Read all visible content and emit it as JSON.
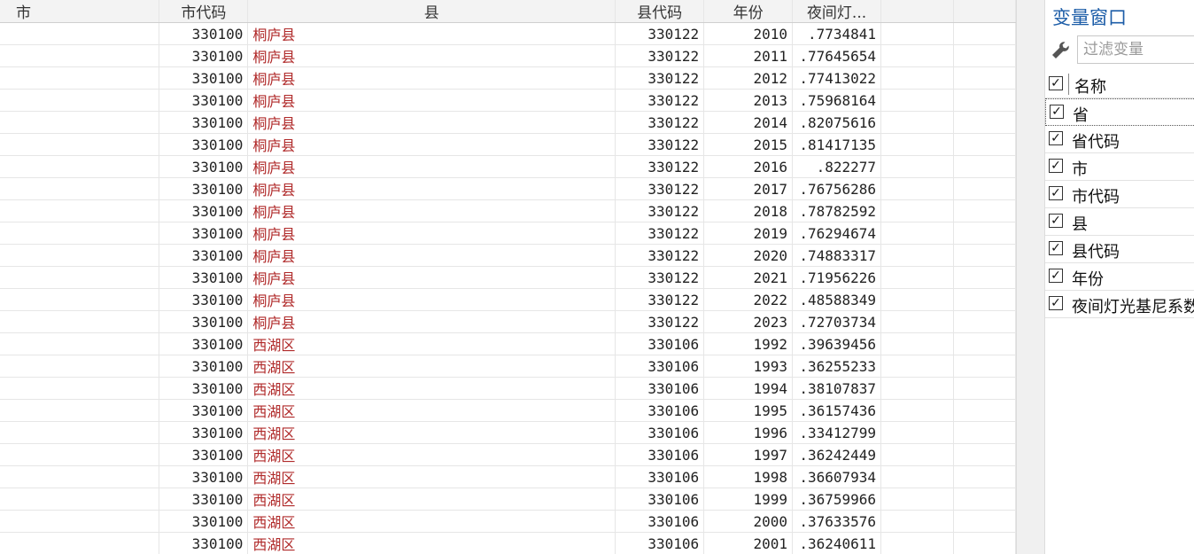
{
  "grid": {
    "columns": [
      "市",
      "市代码",
      "县",
      "县代码",
      "年份",
      "夜间灯..."
    ],
    "rows": [
      [
        "",
        "330100",
        "桐庐县",
        "330122",
        "2010",
        ".7734841"
      ],
      [
        "",
        "330100",
        "桐庐县",
        "330122",
        "2011",
        ".77645654"
      ],
      [
        "",
        "330100",
        "桐庐县",
        "330122",
        "2012",
        ".77413022"
      ],
      [
        "",
        "330100",
        "桐庐县",
        "330122",
        "2013",
        ".75968164"
      ],
      [
        "",
        "330100",
        "桐庐县",
        "330122",
        "2014",
        ".82075616"
      ],
      [
        "",
        "330100",
        "桐庐县",
        "330122",
        "2015",
        ".81417135"
      ],
      [
        "",
        "330100",
        "桐庐县",
        "330122",
        "2016",
        ".822277"
      ],
      [
        "",
        "330100",
        "桐庐县",
        "330122",
        "2017",
        ".76756286"
      ],
      [
        "",
        "330100",
        "桐庐县",
        "330122",
        "2018",
        ".78782592"
      ],
      [
        "",
        "330100",
        "桐庐县",
        "330122",
        "2019",
        ".76294674"
      ],
      [
        "",
        "330100",
        "桐庐县",
        "330122",
        "2020",
        ".74883317"
      ],
      [
        "",
        "330100",
        "桐庐县",
        "330122",
        "2021",
        ".71956226"
      ],
      [
        "",
        "330100",
        "桐庐县",
        "330122",
        "2022",
        ".48588349"
      ],
      [
        "",
        "330100",
        "桐庐县",
        "330122",
        "2023",
        ".72703734"
      ],
      [
        "",
        "330100",
        "西湖区",
        "330106",
        "1992",
        ".39639456"
      ],
      [
        "",
        "330100",
        "西湖区",
        "330106",
        "1993",
        ".36255233"
      ],
      [
        "",
        "330100",
        "西湖区",
        "330106",
        "1994",
        ".38107837"
      ],
      [
        "",
        "330100",
        "西湖区",
        "330106",
        "1995",
        ".36157436"
      ],
      [
        "",
        "330100",
        "西湖区",
        "330106",
        "1996",
        ".33412799"
      ],
      [
        "",
        "330100",
        "西湖区",
        "330106",
        "1997",
        ".36242449"
      ],
      [
        "",
        "330100",
        "西湖区",
        "330106",
        "1998",
        ".36607934"
      ],
      [
        "",
        "330100",
        "西湖区",
        "330106",
        "1999",
        ".36759966"
      ],
      [
        "",
        "330100",
        "西湖区",
        "330106",
        "2000",
        ".37633576"
      ],
      [
        "",
        "330100",
        "西湖区",
        "330106",
        "2001",
        ".36240611"
      ]
    ]
  },
  "variables": {
    "title": "变量窗口",
    "filter_placeholder": "过滤变量",
    "header_label": "名称",
    "items": [
      "省",
      "省代码",
      "市",
      "市代码",
      "县",
      "县代码",
      "年份",
      "夜间灯光基尼系数"
    ],
    "check_glyph": "✓",
    "icons": {
      "filter": "wrench-icon"
    }
  },
  "colors": {
    "string_text": "#b02a2a",
    "title_blue": "#1e5ea8",
    "header_bg": "#f3f3f3"
  }
}
